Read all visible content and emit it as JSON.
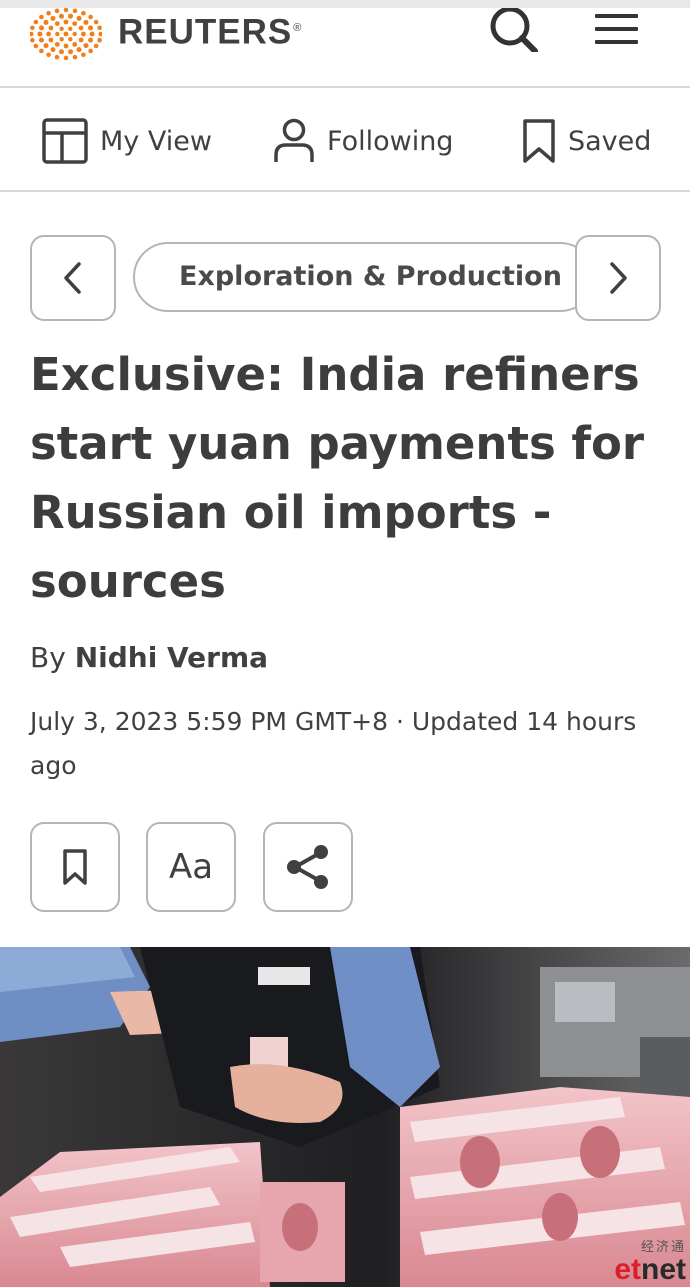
{
  "header": {
    "brand_name": "REUTERS",
    "registered_mark": "®",
    "logo_icon": "reuters-dot-logo",
    "search_icon": "search-icon",
    "menu_icon": "hamburger-menu-icon"
  },
  "nav": {
    "items": [
      {
        "label": "My View",
        "icon": "layout-icon"
      },
      {
        "label": "Following",
        "icon": "person-icon"
      },
      {
        "label": "Saved",
        "icon": "bookmark-icon"
      }
    ]
  },
  "topic_bar": {
    "current_topic": "Exploration & Production",
    "prev_icon": "chevron-left-icon",
    "next_icon": "chevron-right-icon"
  },
  "article": {
    "headline": "Exclusive: India refiners start yuan payments for Russian oil imports - sources",
    "byline_prefix": "By",
    "author": "Nidhi Verma",
    "dateline": "July 3, 2023 5:59 PM GMT+8 · Updated 14 hours ago",
    "tools": {
      "bookmark_icon": "bookmark-icon",
      "text_size_label": "Aa",
      "share_icon": "share-icon"
    },
    "image": {
      "watermark_cn": "经济通",
      "watermark_et": "et",
      "watermark_net": "net"
    }
  },
  "colors": {
    "brand_orange": "#f07f1b",
    "text_dark": "#404040",
    "border_gray": "#b5b5b5",
    "divider_gray": "#d9d9d9",
    "watermark_red": "#d8202a"
  }
}
